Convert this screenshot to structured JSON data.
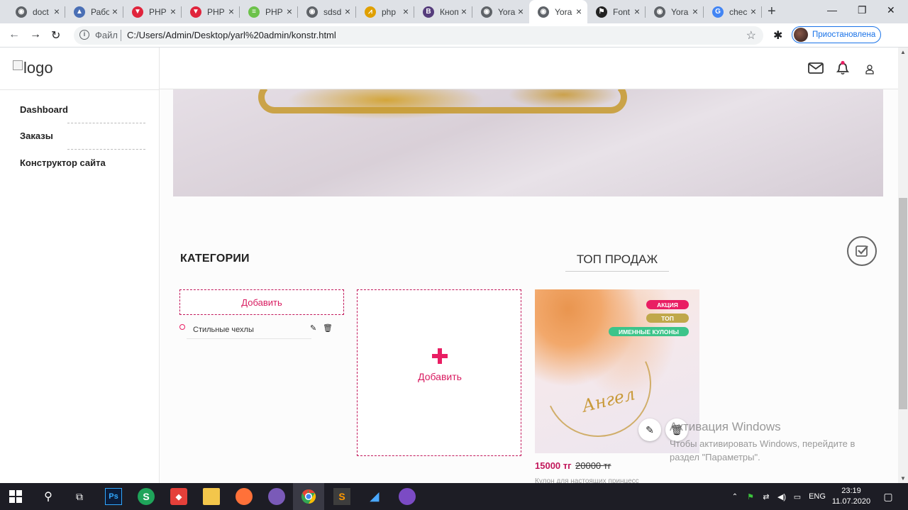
{
  "browser": {
    "tabs": [
      {
        "title": "doct",
        "color": "#5f6368",
        "glyph": "◉"
      },
      {
        "title": "Рабо",
        "color": "#4a6fb5",
        "glyph": "▲"
      },
      {
        "title": "PHP",
        "color": "#e0243c",
        "glyph": "▼"
      },
      {
        "title": "PHP",
        "color": "#e0243c",
        "glyph": "▼"
      },
      {
        "title": "PHP",
        "color": "#6cc24a",
        "glyph": "≡"
      },
      {
        "title": "sdsd",
        "color": "#5f6368",
        "glyph": "◉"
      },
      {
        "title": "php",
        "color": "#e0a000",
        "glyph": "⩘"
      },
      {
        "title": "Кноп",
        "color": "#563d7c",
        "glyph": "B"
      },
      {
        "title": "Yora",
        "color": "#5f6368",
        "glyph": "◉"
      },
      {
        "title": "Yora",
        "color": "#5f6368",
        "glyph": "◉",
        "active": true
      },
      {
        "title": "Font",
        "color": "#222222",
        "glyph": "⚑"
      },
      {
        "title": "Yora",
        "color": "#5f6368",
        "glyph": "◉"
      },
      {
        "title": "chec",
        "color": "#4285f4",
        "glyph": "G"
      }
    ],
    "address": {
      "scheme_label": "Файл",
      "url": "C:/Users/Admin/Desktop/yarl%20admin/konstr.html"
    },
    "profile_label": "Приостановлена"
  },
  "sidebar": {
    "logo_alt": "logo",
    "items": [
      {
        "label": "Dashboard"
      },
      {
        "label": "Заказы"
      },
      {
        "label": "Конструктор сайта"
      }
    ]
  },
  "main": {
    "categories_title": "КАТЕГОРИИ",
    "top_sales_title": "ТОП ПРОДАЖ",
    "add_category_label": "Добавить",
    "category_items": [
      {
        "label": "Стильные чехлы"
      }
    ],
    "add_product_label": "Добавить",
    "product": {
      "badges": [
        {
          "text": "АКЦИЯ",
          "color": "#e91e63"
        },
        {
          "text": "ТОП",
          "color": "#c0a84a"
        },
        {
          "text": "ИМЕННЫЕ КУЛОНЫ",
          "color": "#3cc48a"
        }
      ],
      "price": "15000 тг",
      "old_price": "20000 тг",
      "description": "Кулон для настоящих принцесс"
    }
  },
  "watermark": {
    "title": "Активация Windows",
    "line1": "Чтобы активировать Windows, перейдите в",
    "line2": "раздел \"Параметры\"."
  },
  "taskbar": {
    "lang": "ENG",
    "time": "23:19",
    "date": "11.07.2020"
  }
}
